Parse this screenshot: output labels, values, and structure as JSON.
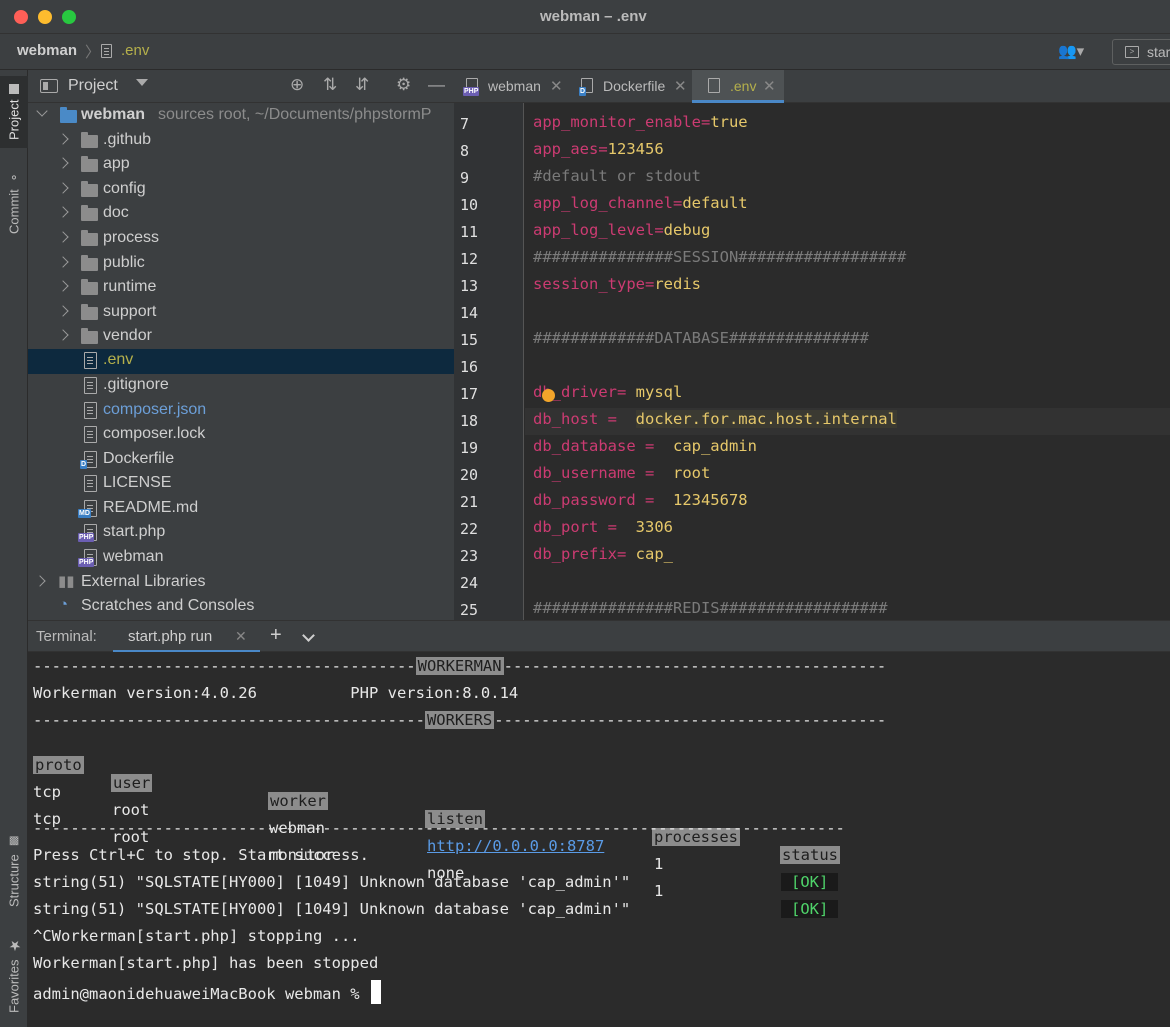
{
  "window": {
    "title": "webman – .env"
  },
  "nav": {
    "project": "webman",
    "file": ".env",
    "run_label": "star"
  },
  "side_tabs": {
    "project": "Project",
    "commit": "Commit",
    "structure": "Structure",
    "favorites": "Favorites"
  },
  "project_panel": {
    "title": "Project",
    "root": {
      "name": "webman",
      "detail": "sources root, ~/Documents/phpstormP"
    },
    "folders": [
      ".github",
      "app",
      "config",
      "doc",
      "process",
      "public",
      "runtime",
      "support",
      "vendor"
    ],
    "files": [
      ".env",
      ".gitignore",
      "composer.json",
      "composer.lock",
      "Dockerfile",
      "LICENSE",
      "README.md",
      "start.php",
      "webman"
    ],
    "external": "External Libraries",
    "scratches": "Scratches and Consoles"
  },
  "editor": {
    "tabs": [
      "webman",
      "Dockerfile",
      ".env"
    ],
    "active_tab": ".env",
    "lines": [
      {
        "n": "7",
        "key": "app_monitor_enable=",
        "val": "true"
      },
      {
        "n": "8",
        "key": "app_aes=",
        "val": "123456"
      },
      {
        "n": "9",
        "comment": "#default or stdout"
      },
      {
        "n": "10",
        "key": "app_log_channel=",
        "val": "default"
      },
      {
        "n": "11",
        "key": "app_log_level=",
        "val": "debug"
      },
      {
        "n": "12",
        "comment": "###############SESSION##################"
      },
      {
        "n": "13",
        "key": "session_type=",
        "val": "redis"
      },
      {
        "n": "14"
      },
      {
        "n": "15",
        "comment": "#############DATABASE###############"
      },
      {
        "n": "16"
      },
      {
        "n": "17",
        "key": "db_driver= ",
        "val": "mysql"
      },
      {
        "n": "18",
        "key": "db_host =  ",
        "val": "docker.for.mac.host.internal"
      },
      {
        "n": "19",
        "key": "db_database =  ",
        "val": "cap_admin"
      },
      {
        "n": "20",
        "key": "db_username =  ",
        "val": "root"
      },
      {
        "n": "21",
        "key": "db_password =  ",
        "val": "12345678"
      },
      {
        "n": "22",
        "key": "db_port =  ",
        "val": "3306"
      },
      {
        "n": "23",
        "key": "db_prefix= ",
        "val": "cap_"
      },
      {
        "n": "24"
      },
      {
        "n": "25",
        "comment": "###############REDIS##################"
      }
    ]
  },
  "terminal": {
    "label": "Terminal:",
    "tab": "start.php run",
    "sep1_label": "WORKERMAN",
    "version_line": "Workerman version:4.0.26          PHP version:8.0.14",
    "sep2_label": "WORKERS",
    "headers": [
      "proto",
      "user",
      "worker",
      "listen",
      "processes",
      "status"
    ],
    "rows": [
      {
        "proto": "tcp",
        "user": "root",
        "worker": "webman",
        "listen": "http://0.0.0.0:8787",
        "processes": "1",
        "status": "[OK]"
      },
      {
        "proto": "tcp",
        "user": "root",
        "worker": "monitor",
        "listen": "none",
        "processes": "1",
        "status": "[OK]"
      }
    ],
    "output": [
      "Press Ctrl+C to stop. Start success.",
      "string(51) \"SQLSTATE[HY000] [1049] Unknown database 'cap_admin'\"",
      "string(51) \"SQLSTATE[HY000] [1049] Unknown database 'cap_admin'\"",
      "^CWorkerman[start.php] stopping ...",
      "Workerman[start.php] has been stopped"
    ],
    "prompt": "admin@maonidehuaweiMacBook webman % "
  }
}
